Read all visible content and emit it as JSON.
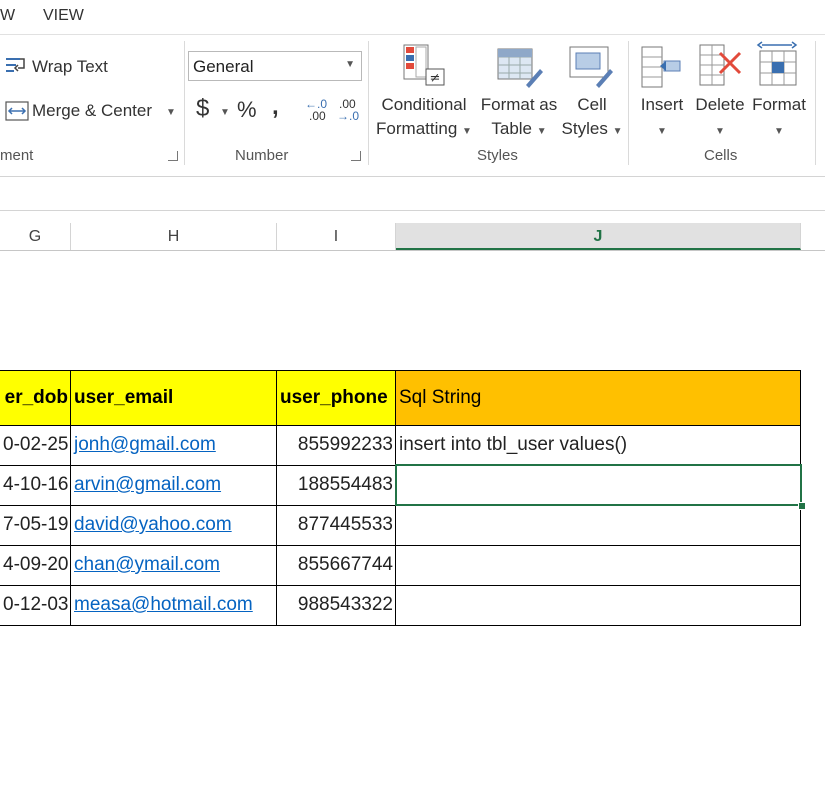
{
  "ribbon_tabs": [
    "W",
    "VIEW"
  ],
  "alignment": {
    "wrap_text": "Wrap Text",
    "merge_center": "Merge & Center",
    "group_label": "ment"
  },
  "number": {
    "format_value": "General",
    "currency": "$",
    "percent": "%",
    "comma": ",",
    "inc_decimal_top": "←.0",
    "inc_decimal_bottom": ".00",
    "dec_decimal_top": ".00",
    "dec_decimal_bottom": "→.0",
    "group_label": "Number"
  },
  "styles": {
    "conditional_line1": "Conditional",
    "conditional_line2": "Formatting",
    "format_table_line1": "Format as",
    "format_table_line2": "Table",
    "cell_styles_line1": "Cell",
    "cell_styles_line2": "Styles",
    "group_label": "Styles"
  },
  "cells": {
    "insert": "Insert",
    "delete": "Delete",
    "format": "Format",
    "group_label": "Cells"
  },
  "columns": [
    "G",
    "H",
    "I",
    "J"
  ],
  "selected_column": "J",
  "table": {
    "headers": [
      "er_dob",
      "user_email",
      "user_phone",
      "Sql String"
    ],
    "rows": [
      {
        "dob": "0-02-25",
        "email": "jonh@gmail.com",
        "phone": "855992233",
        "sql": "insert into tbl_user values()"
      },
      {
        "dob": "4-10-16",
        "email": "arvin@gmail.com",
        "phone": "188554483",
        "sql": ""
      },
      {
        "dob": "7-05-19",
        "email": "david@yahoo.com",
        "phone": "877445533",
        "sql": ""
      },
      {
        "dob": "4-09-20",
        "email": "chan@ymail.com",
        "phone": "855667744",
        "sql": ""
      },
      {
        "dob": "0-12-03",
        "email": "measa@hotmail.com",
        "phone": "988543322",
        "sql": ""
      }
    ]
  },
  "colors": {
    "header_yellow": "#ffff00",
    "header_orange": "#ffc000",
    "excel_green": "#217346",
    "link_blue": "#0563c1"
  }
}
